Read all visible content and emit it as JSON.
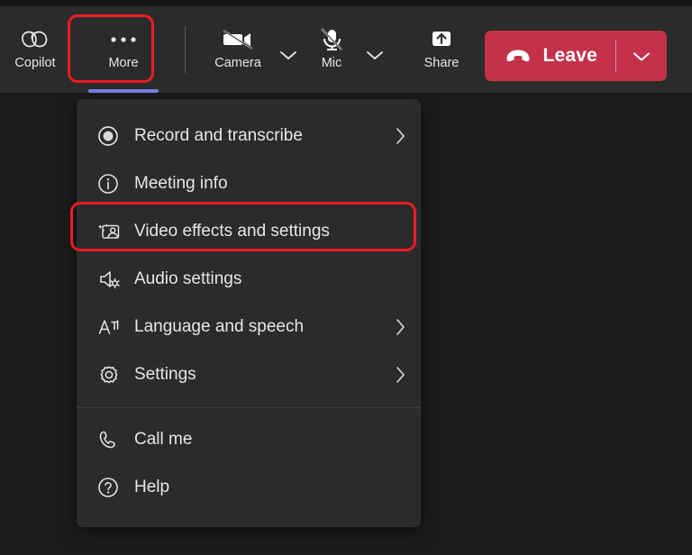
{
  "toolbar": {
    "copilot": {
      "label": "Copilot",
      "icon": "copilot-icon"
    },
    "more": {
      "label": "More",
      "icon": "more-ellipsis-icon",
      "active": true,
      "active_color": "#7b83eb"
    },
    "camera": {
      "label": "Camera",
      "icon": "camera-off-icon",
      "state": "off",
      "chevron": "chevron-down-icon"
    },
    "mic": {
      "label": "Mic",
      "icon": "microphone-off-icon",
      "state": "off",
      "chevron": "chevron-down-icon"
    },
    "share": {
      "label": "Share",
      "icon": "share-screen-icon"
    },
    "leave": {
      "label": "Leave",
      "icon": "hang-up-icon",
      "chevron": "chevron-down-icon",
      "color": "#c4314b"
    }
  },
  "menu": {
    "groups": [
      {
        "items": [
          {
            "label": "Record and transcribe",
            "icon": "record-icon",
            "has_submenu": true
          },
          {
            "label": "Meeting info",
            "icon": "info-icon",
            "has_submenu": false
          },
          {
            "label": "Video effects and settings",
            "icon": "video-effects-icon",
            "has_submenu": false,
            "highlighted": true
          },
          {
            "label": "Audio settings",
            "icon": "speaker-settings-icon",
            "has_submenu": false
          },
          {
            "label": "Language and speech",
            "icon": "language-icon",
            "has_submenu": true
          },
          {
            "label": "Settings",
            "icon": "gear-icon",
            "has_submenu": true
          }
        ]
      },
      {
        "items": [
          {
            "label": "Call me",
            "icon": "phone-icon",
            "has_submenu": false
          },
          {
            "label": "Help",
            "icon": "help-icon",
            "has_submenu": false
          }
        ]
      }
    ]
  },
  "annotations": {
    "color": "#ed1c24",
    "boxes": [
      {
        "target": "more-button"
      },
      {
        "target": "video-effects-and-settings-menu-item"
      }
    ]
  }
}
